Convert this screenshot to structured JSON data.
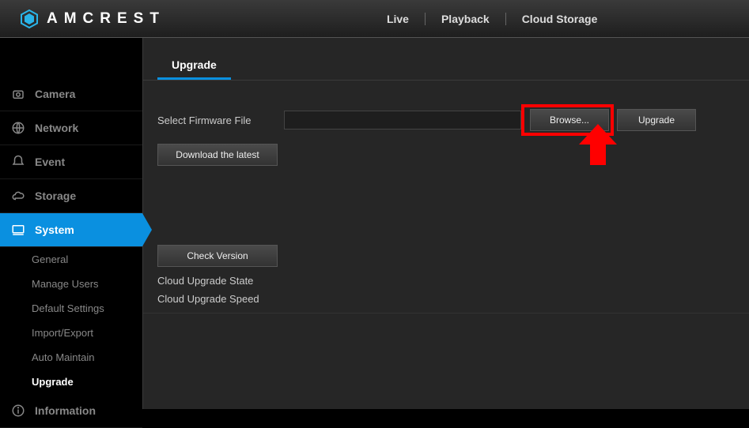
{
  "brand": "AMCREST",
  "topnav": {
    "live": "Live",
    "playback": "Playback",
    "cloud": "Cloud Storage"
  },
  "sidebar": {
    "camera": "Camera",
    "network": "Network",
    "event": "Event",
    "storage": "Storage",
    "system": "System",
    "system_sub": {
      "general": "General",
      "manage_users": "Manage Users",
      "default_settings": "Default Settings",
      "import_export": "Import/Export",
      "auto_maintain": "Auto Maintain",
      "upgrade": "Upgrade"
    },
    "information": "Information"
  },
  "content": {
    "tab": "Upgrade",
    "select_label": "Select Firmware File",
    "browse": "Browse...",
    "upgrade_btn": "Upgrade",
    "download": "Download the latest",
    "check": "Check Version",
    "cloud_state": "Cloud Upgrade State",
    "cloud_speed": "Cloud Upgrade Speed"
  }
}
